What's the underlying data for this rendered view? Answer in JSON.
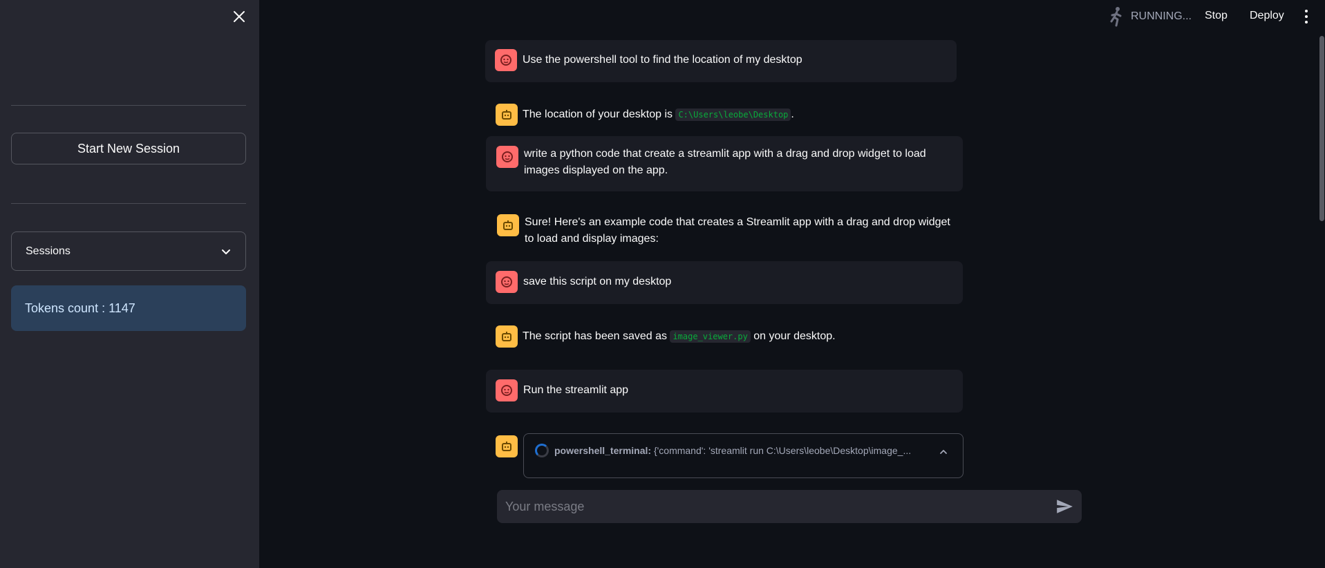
{
  "sidebar": {
    "new_session_label": "Start New Session",
    "sessions_label": "Sessions",
    "tokens_label": "Tokens count : 1147"
  },
  "header": {
    "status": "RUNNING...",
    "stop_label": "Stop",
    "deploy_label": "Deploy"
  },
  "chat": {
    "messages": [
      {
        "role": "user",
        "text": "Use the powershell tool to find the location of my desktop"
      },
      {
        "role": "assistant",
        "text_before": "The location of your desktop is ",
        "code": "C:\\Users\\leobe\\Desktop",
        "text_after": "."
      },
      {
        "role": "user",
        "text": "write a python code that create a streamlit app with a drag and drop widget to load images displayed on the app."
      },
      {
        "role": "assistant",
        "text": "Sure! Here's an example code that creates a Streamlit app with a drag and drop widget to load and display images:"
      },
      {
        "role": "user",
        "text": "save this script on my desktop"
      },
      {
        "role": "assistant",
        "text_before": "The script has been saved as ",
        "code": "image_viewer.py",
        "text_after": " on your desktop."
      },
      {
        "role": "user",
        "text": "Run the streamlit app"
      }
    ],
    "tool": {
      "name": "powershell_terminal:",
      "args": "{'command': 'streamlit run C:\\Users\\leobe\\Desktop\\image_..."
    }
  },
  "input": {
    "placeholder": "Your message"
  },
  "colors": {
    "user_avatar": "#ff6b6b",
    "bot_avatar": "#ffbd45",
    "code_text": "#09ab3b",
    "tokens_bg": "#2b405a"
  }
}
